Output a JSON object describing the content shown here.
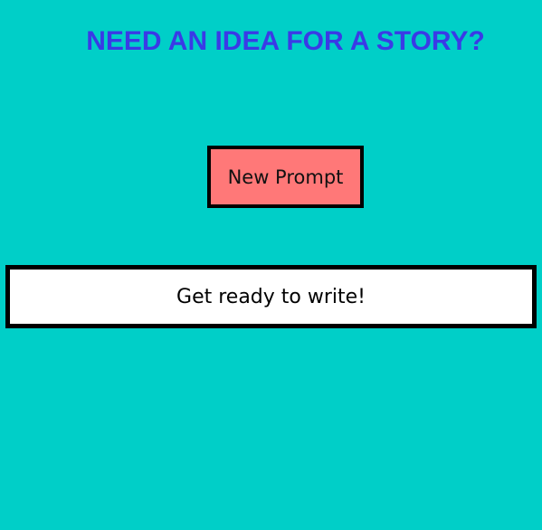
{
  "page": {
    "title": "NEED AN IDEA FOR A STORY?",
    "colors": {
      "background": "#00cfc8",
      "title": "#3a3ae6",
      "button_background": "#ff7878",
      "prompt_box_background": "#ffffff",
      "border": "#000000"
    }
  },
  "controls": {
    "new_prompt_label": "New Prompt"
  },
  "prompt": {
    "text": "Get ready to write!"
  }
}
